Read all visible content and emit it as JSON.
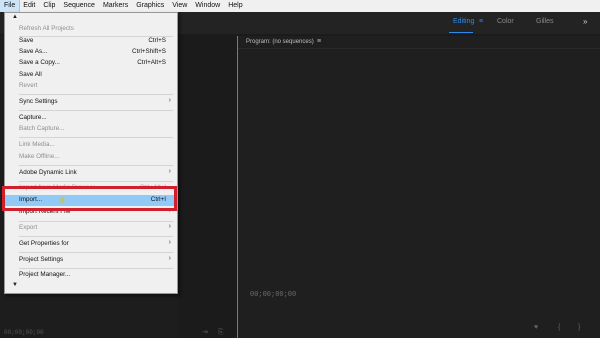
{
  "menubar": {
    "items": [
      "File",
      "Edit",
      "Clip",
      "Sequence",
      "Markers",
      "Graphics",
      "View",
      "Window",
      "Help"
    ]
  },
  "workspaces": {
    "items": [
      "Editing",
      "Color",
      "Gilles"
    ],
    "menu_glyph": "≡",
    "more_glyph": "»"
  },
  "file_menu": {
    "items": {
      "refresh": {
        "label": "Refresh All Projects"
      },
      "save": {
        "label": "Save",
        "shortcut": "Ctrl+S"
      },
      "save_as": {
        "label": "Save As...",
        "shortcut": "Ctrl+Shift+S"
      },
      "save_copy": {
        "label": "Save a Copy...",
        "shortcut": "Ctrl+Alt+S"
      },
      "save_all": {
        "label": "Save All"
      },
      "revert": {
        "label": "Revert"
      },
      "sync_settings": {
        "label": "Sync Settings"
      },
      "capture": {
        "label": "Capture..."
      },
      "batch_capture": {
        "label": "Batch Capture..."
      },
      "link_media": {
        "label": "Link Media..."
      },
      "make_offline": {
        "label": "Make Offline..."
      },
      "dynamic_link": {
        "label": "Adobe Dynamic Link"
      },
      "import_browser": {
        "label": "Import from Media Browser",
        "shortcut": "Ctrl+Alt+I"
      },
      "import": {
        "label": "Import...",
        "shortcut": "Ctrl+I"
      },
      "import_recent": {
        "label": "Import Recent File"
      },
      "export": {
        "label": "Export"
      },
      "get_properties": {
        "label": "Get Properties for"
      },
      "project_settings": {
        "label": "Project Settings"
      },
      "project_manager": {
        "label": "Project Manager..."
      }
    },
    "submenu_glyph": "›"
  },
  "program_monitor": {
    "title": "Program: (no sequences)",
    "menu_glyph": "≡",
    "timecode": "00;00;00;00"
  },
  "source_panel": {
    "timecode": "00;00;00;00"
  },
  "colors": {
    "accent": "#2d8ceb",
    "highlight": "#91c9f7",
    "annotation_red": "#d11f2c"
  }
}
